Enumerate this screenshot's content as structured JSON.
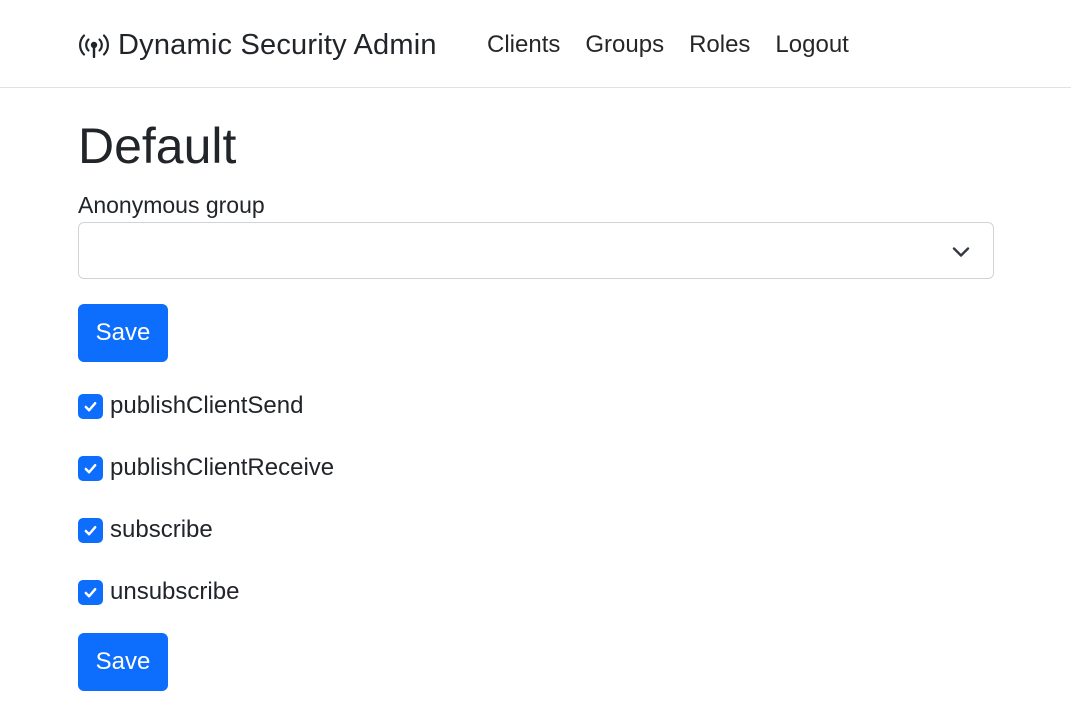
{
  "navbar": {
    "brand_icon": "broadcast-icon",
    "brand": "Dynamic Security Admin",
    "links": [
      {
        "label": "Clients"
      },
      {
        "label": "Groups"
      },
      {
        "label": "Roles"
      },
      {
        "label": "Logout"
      }
    ]
  },
  "page": {
    "title": "Default"
  },
  "anonymous_group": {
    "label": "Anonymous group",
    "selected_value": "",
    "dropdown_icon": "chevron-down-icon"
  },
  "buttons": {
    "save_top": "Save",
    "save_bottom": "Save"
  },
  "permissions": [
    {
      "label": "publishClientSend",
      "checked": true
    },
    {
      "label": "publishClientReceive",
      "checked": true
    },
    {
      "label": "subscribe",
      "checked": true
    },
    {
      "label": "unsubscribe",
      "checked": true
    }
  ],
  "colors": {
    "primary": "#0d6efd",
    "text": "#212529",
    "border": "#ced4da"
  }
}
